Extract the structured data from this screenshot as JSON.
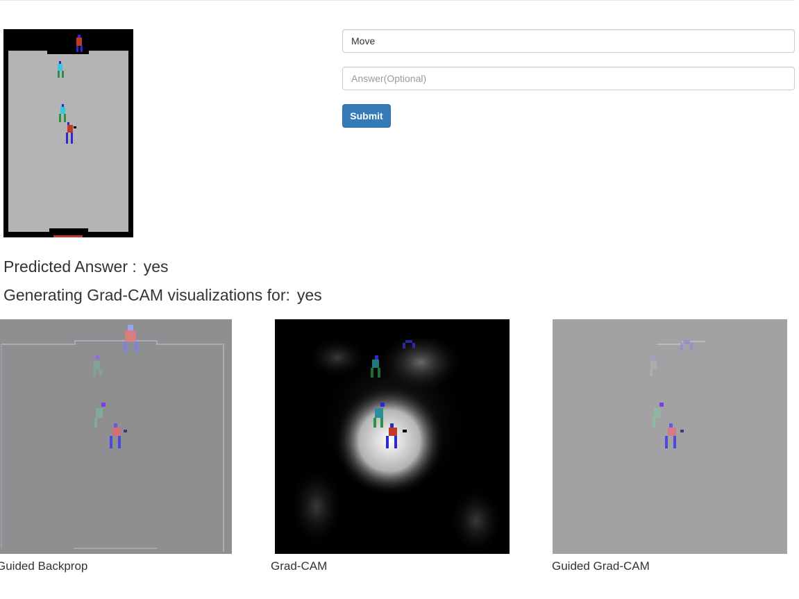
{
  "form": {
    "question_value": "Move",
    "answer_placeholder": "Answer(Optional)",
    "submit_label": "Submit"
  },
  "results": {
    "predicted_label": "Predicted Answer :",
    "predicted_value": "yes",
    "generating_label": "Generating Grad-CAM visualizations for:",
    "generating_value": "yes"
  },
  "visualizations": [
    {
      "caption": "Guided Backprop"
    },
    {
      "caption": "Grad-CAM"
    },
    {
      "caption": "Guided Grad-CAM"
    }
  ],
  "colors": {
    "primary_button": "#337ab7",
    "field_border": "#cccccc",
    "court_gray": "#b4b4b4",
    "player_red": "#c0392b",
    "player_blue": "#2a2ad0",
    "player_cyan": "#3cc8dc",
    "player_green": "#2f8f4a"
  }
}
